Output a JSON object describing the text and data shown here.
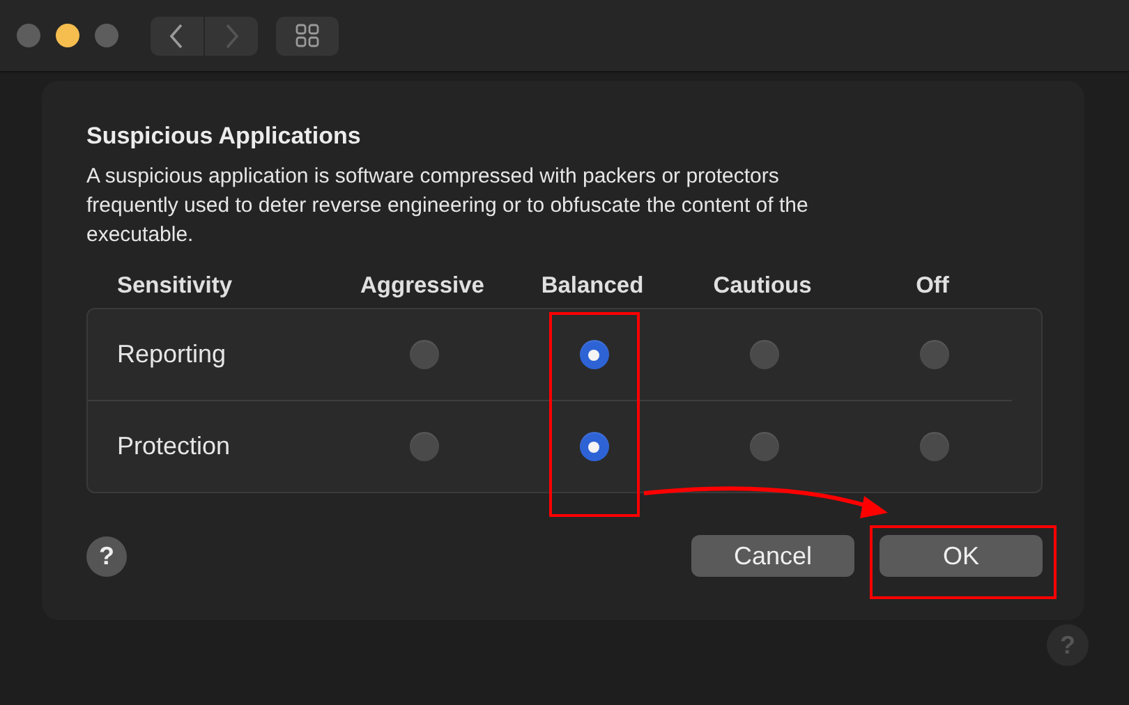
{
  "toolbar": {
    "traffic_lights": [
      {
        "active": false
      },
      {
        "active": true
      },
      {
        "active": false
      }
    ],
    "back_enabled": true,
    "forward_enabled": false
  },
  "dialog": {
    "title": "Suspicious Applications",
    "description": "A suspicious application is software compressed with packers or protectors frequently used to deter reverse engineering or to obfuscate the content of the executable.",
    "columns": [
      "Sensitivity",
      "Aggressive",
      "Balanced",
      "Cautious",
      "Off"
    ],
    "rows": [
      {
        "label": "Reporting",
        "options": [
          {
            "selected": false
          },
          {
            "selected": true
          },
          {
            "selected": false
          },
          {
            "selected": false
          }
        ]
      },
      {
        "label": "Protection",
        "options": [
          {
            "selected": false
          },
          {
            "selected": true
          },
          {
            "selected": false
          },
          {
            "selected": false
          }
        ]
      }
    ],
    "help": "?",
    "buttons": [
      {
        "label": "Cancel"
      },
      {
        "label": "OK"
      }
    ]
  },
  "window_help": "?"
}
